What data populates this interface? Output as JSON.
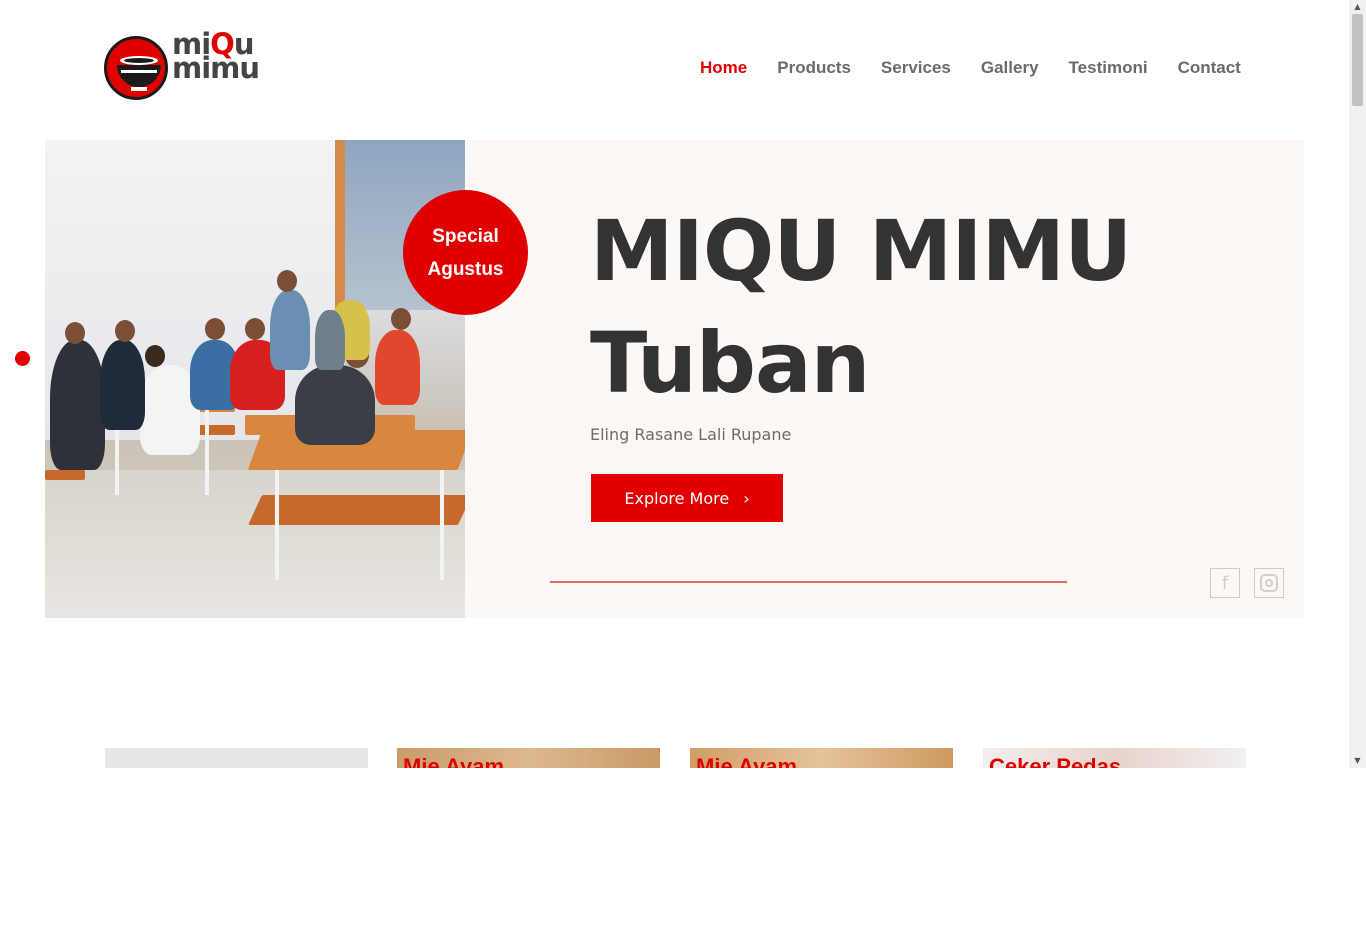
{
  "brand": {
    "logo_line1_a": "mi",
    "logo_line1_b": "Q",
    "logo_line1_c": "u",
    "logo_line2": "mimu",
    "accent_color": "#e10000"
  },
  "nav": {
    "items": [
      {
        "label": "Home",
        "active": true
      },
      {
        "label": "Products",
        "active": false
      },
      {
        "label": "Services",
        "active": false
      },
      {
        "label": "Gallery",
        "active": false
      },
      {
        "label": "Testimoni",
        "active": false
      },
      {
        "label": "Contact",
        "active": false
      }
    ]
  },
  "hero": {
    "badge_line1": "Special",
    "badge_line2": "Agustus",
    "title_line1": "MIQU MIMU",
    "title_line2": "Tuban",
    "subtitle": "Eling Rasane Lali Rupane",
    "button_label": "Explore More",
    "button_icon": "chevron-right-icon",
    "social": [
      {
        "name": "facebook-icon",
        "glyph": "f"
      },
      {
        "name": "instagram-icon",
        "glyph": ""
      }
    ]
  },
  "products": {
    "cards": [
      {
        "label": ""
      },
      {
        "label": "Mie Ayam"
      },
      {
        "label": "Mie Ayam"
      },
      {
        "label": "Ceker Pedas"
      }
    ]
  },
  "scrollbar": {
    "up": "▲",
    "down": "▼"
  }
}
